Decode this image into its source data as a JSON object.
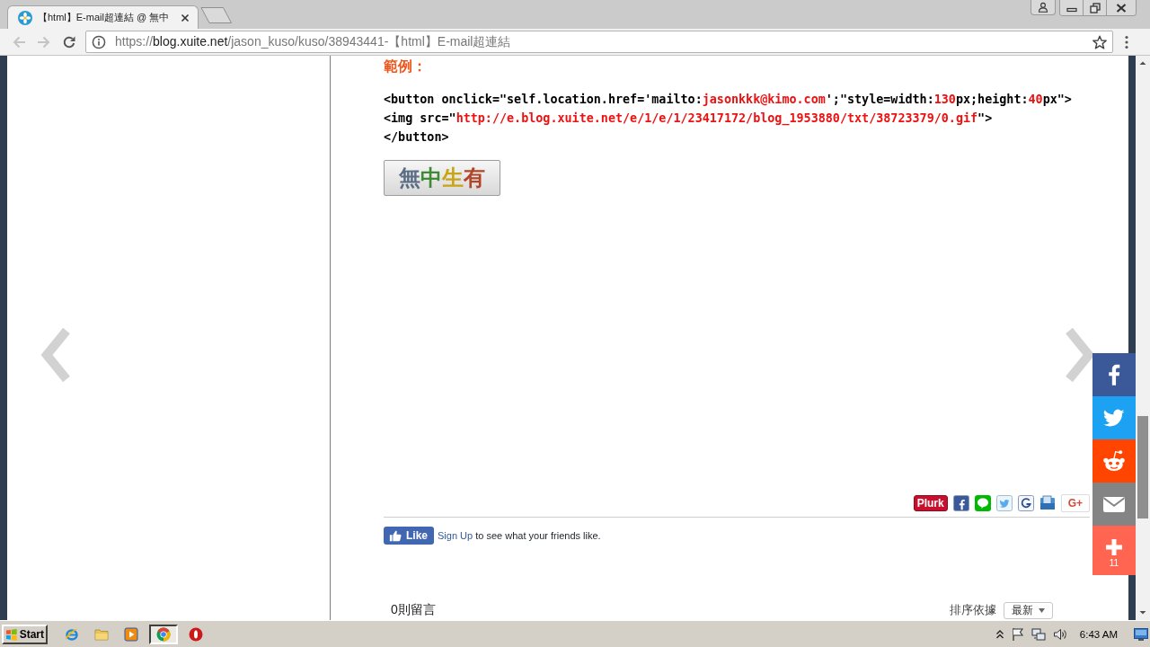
{
  "browser": {
    "tabs": [
      {
        "title": "【html】E-mail超連結 @ 無中",
        "selected": true
      }
    ],
    "toolbar": {
      "back": {
        "disabled": true
      },
      "forward": {
        "disabled": true
      },
      "url": {
        "scheme": "https://",
        "host": "blog.xuite.net",
        "path": "/jason_kuso/kuso/38943441-【html】E-mail超連結"
      }
    }
  },
  "article": {
    "heading": "範例：",
    "code_lines": [
      {
        "segments": [
          {
            "text": "<button onclick=\"self.location.href='mailto:",
            "highlighted": false
          },
          {
            "text": "jasonkkk@kimo.com",
            "highlighted": true
          },
          {
            "text": "';\"style=width:",
            "highlighted": false
          },
          {
            "text": "130",
            "highlighted": true
          },
          {
            "text": "px;height:",
            "highlighted": false
          },
          {
            "text": "40",
            "highlighted": true
          },
          {
            "text": "px\">",
            "highlighted": false
          }
        ]
      },
      {
        "segments": [
          {
            "text": "<img src=\"",
            "highlighted": false
          },
          {
            "text": "http://e.blog.xuite.net/e/1/e/1/23417172/blog_1953880/txt/38723379/0.gif",
            "highlighted": true
          },
          {
            "text": "\">",
            "highlighted": false
          }
        ]
      },
      {
        "segments": [
          {
            "text": "</button>",
            "highlighted": false
          }
        ]
      }
    ],
    "demo_button": {
      "label": "無中生有"
    },
    "share_buttons": [
      {
        "kind": "plurk",
        "label": "Plurk"
      },
      {
        "kind": "facebook"
      },
      {
        "kind": "line"
      },
      {
        "kind": "twitter"
      },
      {
        "kind": "google"
      },
      {
        "kind": "bookmark"
      },
      {
        "kind": "googleplus",
        "label": "G+"
      }
    ],
    "like_bar": {
      "button": "Like",
      "link": "Sign Up",
      "text": "to see what your friends like."
    },
    "comments": {
      "count": "0則留言",
      "sort_label": "排序依據",
      "sort_value": "最新"
    }
  },
  "floating_share": [
    {
      "kind": "facebook"
    },
    {
      "kind": "twitter"
    },
    {
      "kind": "reddit"
    },
    {
      "kind": "email"
    },
    {
      "kind": "more",
      "count": "11"
    }
  ],
  "taskbar": {
    "start": "Start",
    "apps": [
      {
        "kind": "ie",
        "selected": false
      },
      {
        "kind": "folder",
        "selected": false
      },
      {
        "kind": "media",
        "selected": false
      },
      {
        "kind": "chrome",
        "selected": true
      },
      {
        "kind": "opera",
        "selected": false
      }
    ],
    "clock": "6:43 AM"
  }
}
